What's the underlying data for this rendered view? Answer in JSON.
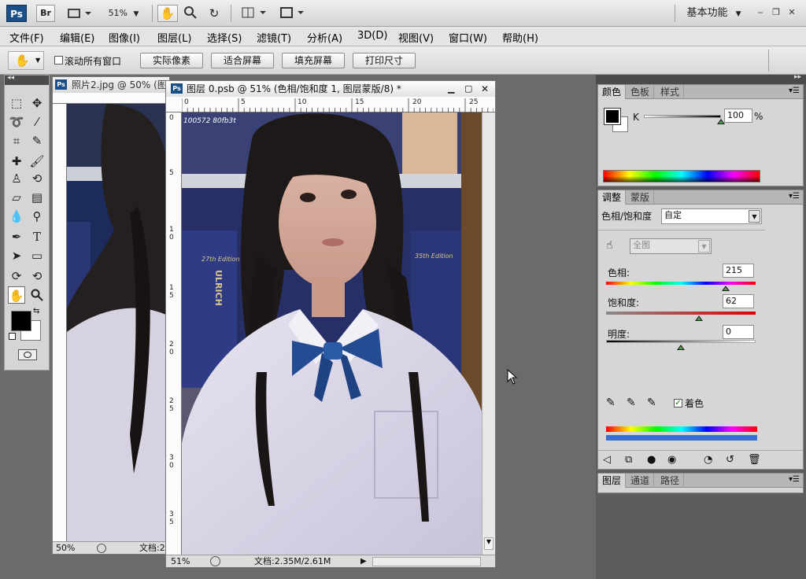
{
  "appbar": {
    "logo": "Ps",
    "bridge": "Br",
    "zoom": "51%",
    "workspace": "基本功能"
  },
  "menu": [
    "文件(F)",
    "编辑(E)",
    "图像(I)",
    "图层(L)",
    "选择(S)",
    "滤镜(T)",
    "分析(A)",
    "3D(D)",
    "视图(V)",
    "窗口(W)",
    "帮助(H)"
  ],
  "options": {
    "scroll_all_label": "滚动所有窗口",
    "buttons": [
      "实际像素",
      "适合屏幕",
      "填充屏幕",
      "打印尺寸"
    ]
  },
  "doc_back": {
    "title": "照片2.jpg @ 50% (图",
    "zoom": "50%",
    "status": "文档:2"
  },
  "doc_front": {
    "title": "图层 0.psb @ 51% (色相/饱和度 1, 图层蒙版/8) *",
    "zoom": "51%",
    "status": "文档:2.35M/2.61M",
    "ruler_h": [
      "0",
      "5",
      "10",
      "15",
      "20",
      "25"
    ],
    "ruler_v": [
      "0",
      "5",
      "1\n0",
      "1\n5",
      "2\n0",
      "2\n5",
      "3\n0",
      "3\n5"
    ]
  },
  "photo_text": {
    "overlay": "100572 80fb3t",
    "book_edition_1": "27th Edition",
    "book_edition_2": "35th Edition",
    "book_name": "ULRICH"
  },
  "color_panel": {
    "tabs": [
      "颜色",
      "色板",
      "样式"
    ],
    "channel": "K",
    "value": "100",
    "unit": "%"
  },
  "adjust_panel": {
    "tabs": [
      "调整",
      "蒙版"
    ],
    "type": "色相/饱和度",
    "preset": "自定",
    "range": "全图",
    "hue_label": "色相:",
    "hue_value": "215",
    "hue_level": 0.8,
    "sat_label": "饱和度:",
    "sat_value": "62",
    "sat_level": 0.62,
    "light_label": "明度:",
    "light_value": "0",
    "light_level": 0.5,
    "colorize_label": "着色",
    "colorize_checked": true
  },
  "layers_panel": {
    "tabs": [
      "图层",
      "通道",
      "路径"
    ]
  }
}
